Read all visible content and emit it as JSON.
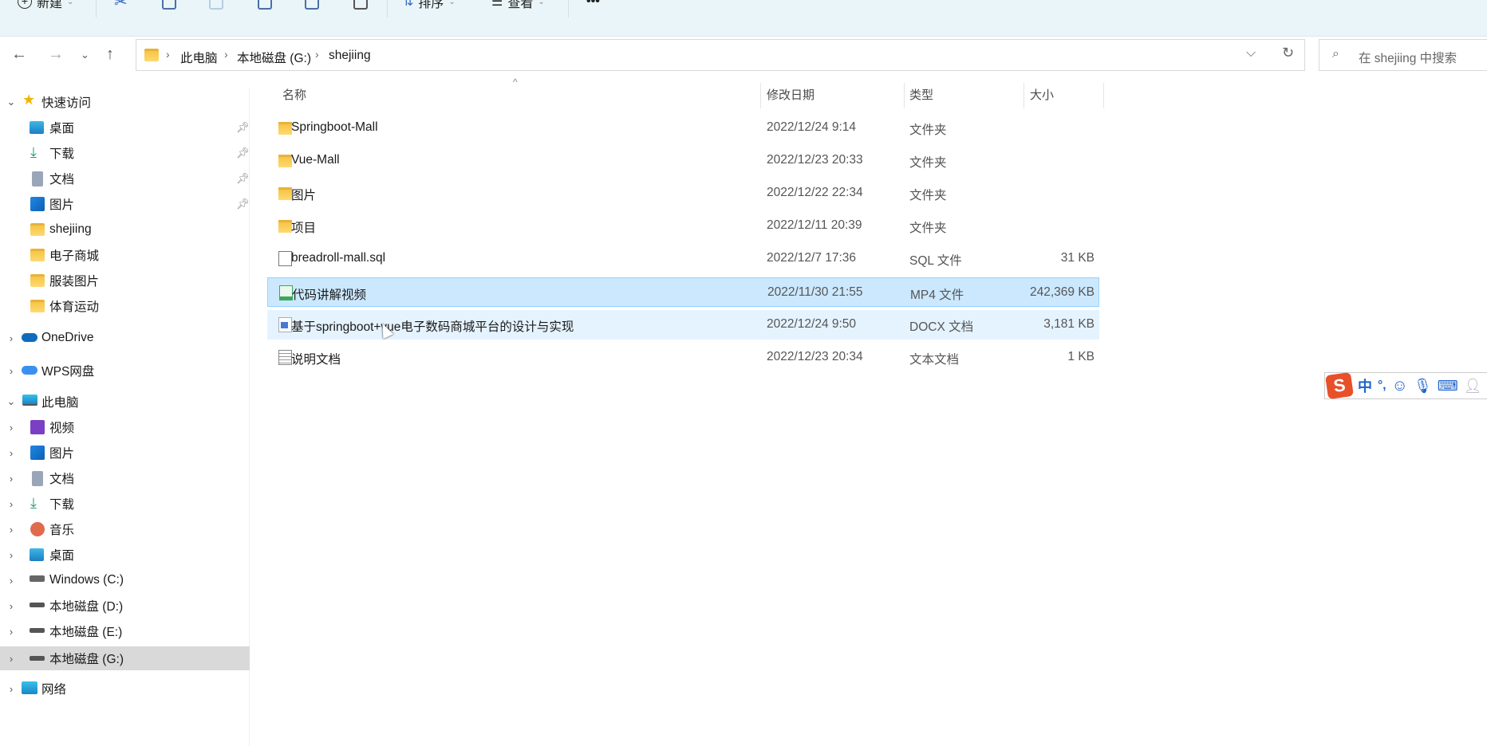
{
  "toolbar": {
    "new_label": "新建",
    "sort_label": "排序",
    "view_label": "查看",
    "more_label": "•••"
  },
  "address": {
    "crumbs": [
      "此电脑",
      "本地磁盘 (G:)",
      "shejiing"
    ]
  },
  "search": {
    "placeholder": "在 shejiing 中搜索"
  },
  "sidebar": {
    "quick_access": "快速访问",
    "quick_items": [
      "桌面",
      "下载",
      "文档",
      "图片",
      "shejiing",
      "电子商城",
      "服装图片",
      "体育运动"
    ],
    "onedrive": "OneDrive",
    "wps": "WPS网盘",
    "this_pc": "此电脑",
    "pc_items": [
      "视频",
      "图片",
      "文档",
      "下载",
      "音乐",
      "桌面",
      "Windows (C:)",
      "本地磁盘 (D:)",
      "本地磁盘 (E:)",
      "本地磁盘 (G:)"
    ],
    "network": "网络"
  },
  "columns": {
    "name": "名称",
    "date": "修改日期",
    "type": "类型",
    "size": "大小"
  },
  "files": [
    {
      "name": "Springboot-Mall",
      "date": "2022/12/24 9:14",
      "type": "文件夹",
      "size": ""
    },
    {
      "name": "Vue-Mall",
      "date": "2022/12/23 20:33",
      "type": "文件夹",
      "size": ""
    },
    {
      "name": "图片",
      "date": "2022/12/22 22:34",
      "type": "文件夹",
      "size": ""
    },
    {
      "name": "项目",
      "date": "2022/12/11 20:39",
      "type": "文件夹",
      "size": ""
    },
    {
      "name": "breadroll-mall.sql",
      "date": "2022/12/7 17:36",
      "type": "SQL 文件",
      "size": "31 KB"
    },
    {
      "name": "代码讲解视频",
      "date": "2022/11/30 21:55",
      "type": "MP4 文件",
      "size": "242,369 KB"
    },
    {
      "name": "基于springboot+vue电子数码商城平台的设计与实现",
      "date": "2022/12/24 9:50",
      "type": "DOCX 文档",
      "size": "3,181 KB"
    },
    {
      "name": "说明文档",
      "date": "2022/12/23 20:34",
      "type": "文本文档",
      "size": "1 KB"
    }
  ],
  "ime": {
    "mode": "中",
    "punct": "°,"
  }
}
